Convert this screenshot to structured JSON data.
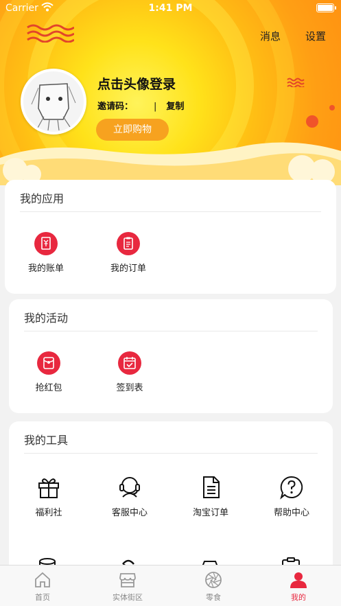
{
  "status_bar": {
    "carrier": "Carrier",
    "time": "1:41 PM"
  },
  "header": {
    "messages_label": "消息",
    "settings_label": "设置",
    "login_title": "点击头像登录",
    "invite_label": "邀请码：",
    "invite_separator": "|",
    "copy_label": "复制",
    "shop_button_label": "立即购物"
  },
  "sections": {
    "apps": {
      "title": "我的应用",
      "items": [
        {
          "label": "我的账单",
          "icon": "bill-icon"
        },
        {
          "label": "我的订单",
          "icon": "order-icon"
        }
      ]
    },
    "activities": {
      "title": "我的活动",
      "items": [
        {
          "label": "抢红包",
          "icon": "red-envelope-icon"
        },
        {
          "label": "签到表",
          "icon": "calendar-check-icon"
        }
      ]
    },
    "tools": {
      "title": "我的工具",
      "items": [
        {
          "label": "福利社",
          "icon": "gift-icon"
        },
        {
          "label": "客服中心",
          "icon": "headset-icon"
        },
        {
          "label": "淘宝订单",
          "icon": "document-icon"
        },
        {
          "label": "帮助中心",
          "icon": "help-icon"
        }
      ]
    }
  },
  "tabbar": {
    "tabs": [
      {
        "label": "首页",
        "icon": "home-icon",
        "active": false
      },
      {
        "label": "实体街区",
        "icon": "store-icon",
        "active": false
      },
      {
        "label": "零食",
        "icon": "aperture-icon",
        "active": false
      },
      {
        "label": "我的",
        "icon": "user-icon",
        "active": true
      }
    ]
  },
  "colors": {
    "accent": "#e8283f",
    "header_orange": "#ff9f14",
    "button_orange": "#f7a21f"
  }
}
